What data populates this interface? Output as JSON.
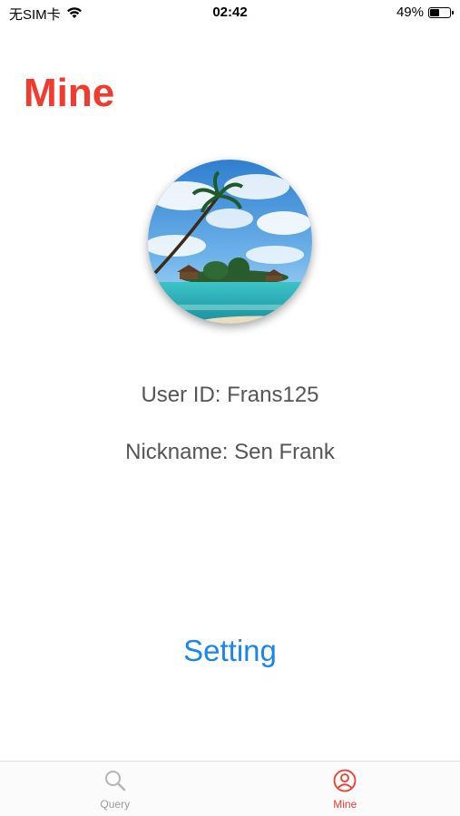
{
  "status_bar": {
    "carrier": "无SIM卡",
    "time": "02:42",
    "battery_percent": "49%",
    "battery_level": 0.49
  },
  "header": {
    "title": "Mine"
  },
  "profile": {
    "user_id_text": "User ID: Frans125",
    "nickname_text": "Nickname: Sen Frank"
  },
  "actions": {
    "setting_label": "Setting"
  },
  "tab_bar": {
    "tabs": [
      {
        "label": "Query",
        "icon": "search-icon",
        "active": false
      },
      {
        "label": "Mine",
        "icon": "user-icon",
        "active": true
      }
    ]
  },
  "colors": {
    "accent_red": "#f23b2f",
    "link_blue": "#1a84f0",
    "inactive_gray": "#9b9b9b"
  }
}
